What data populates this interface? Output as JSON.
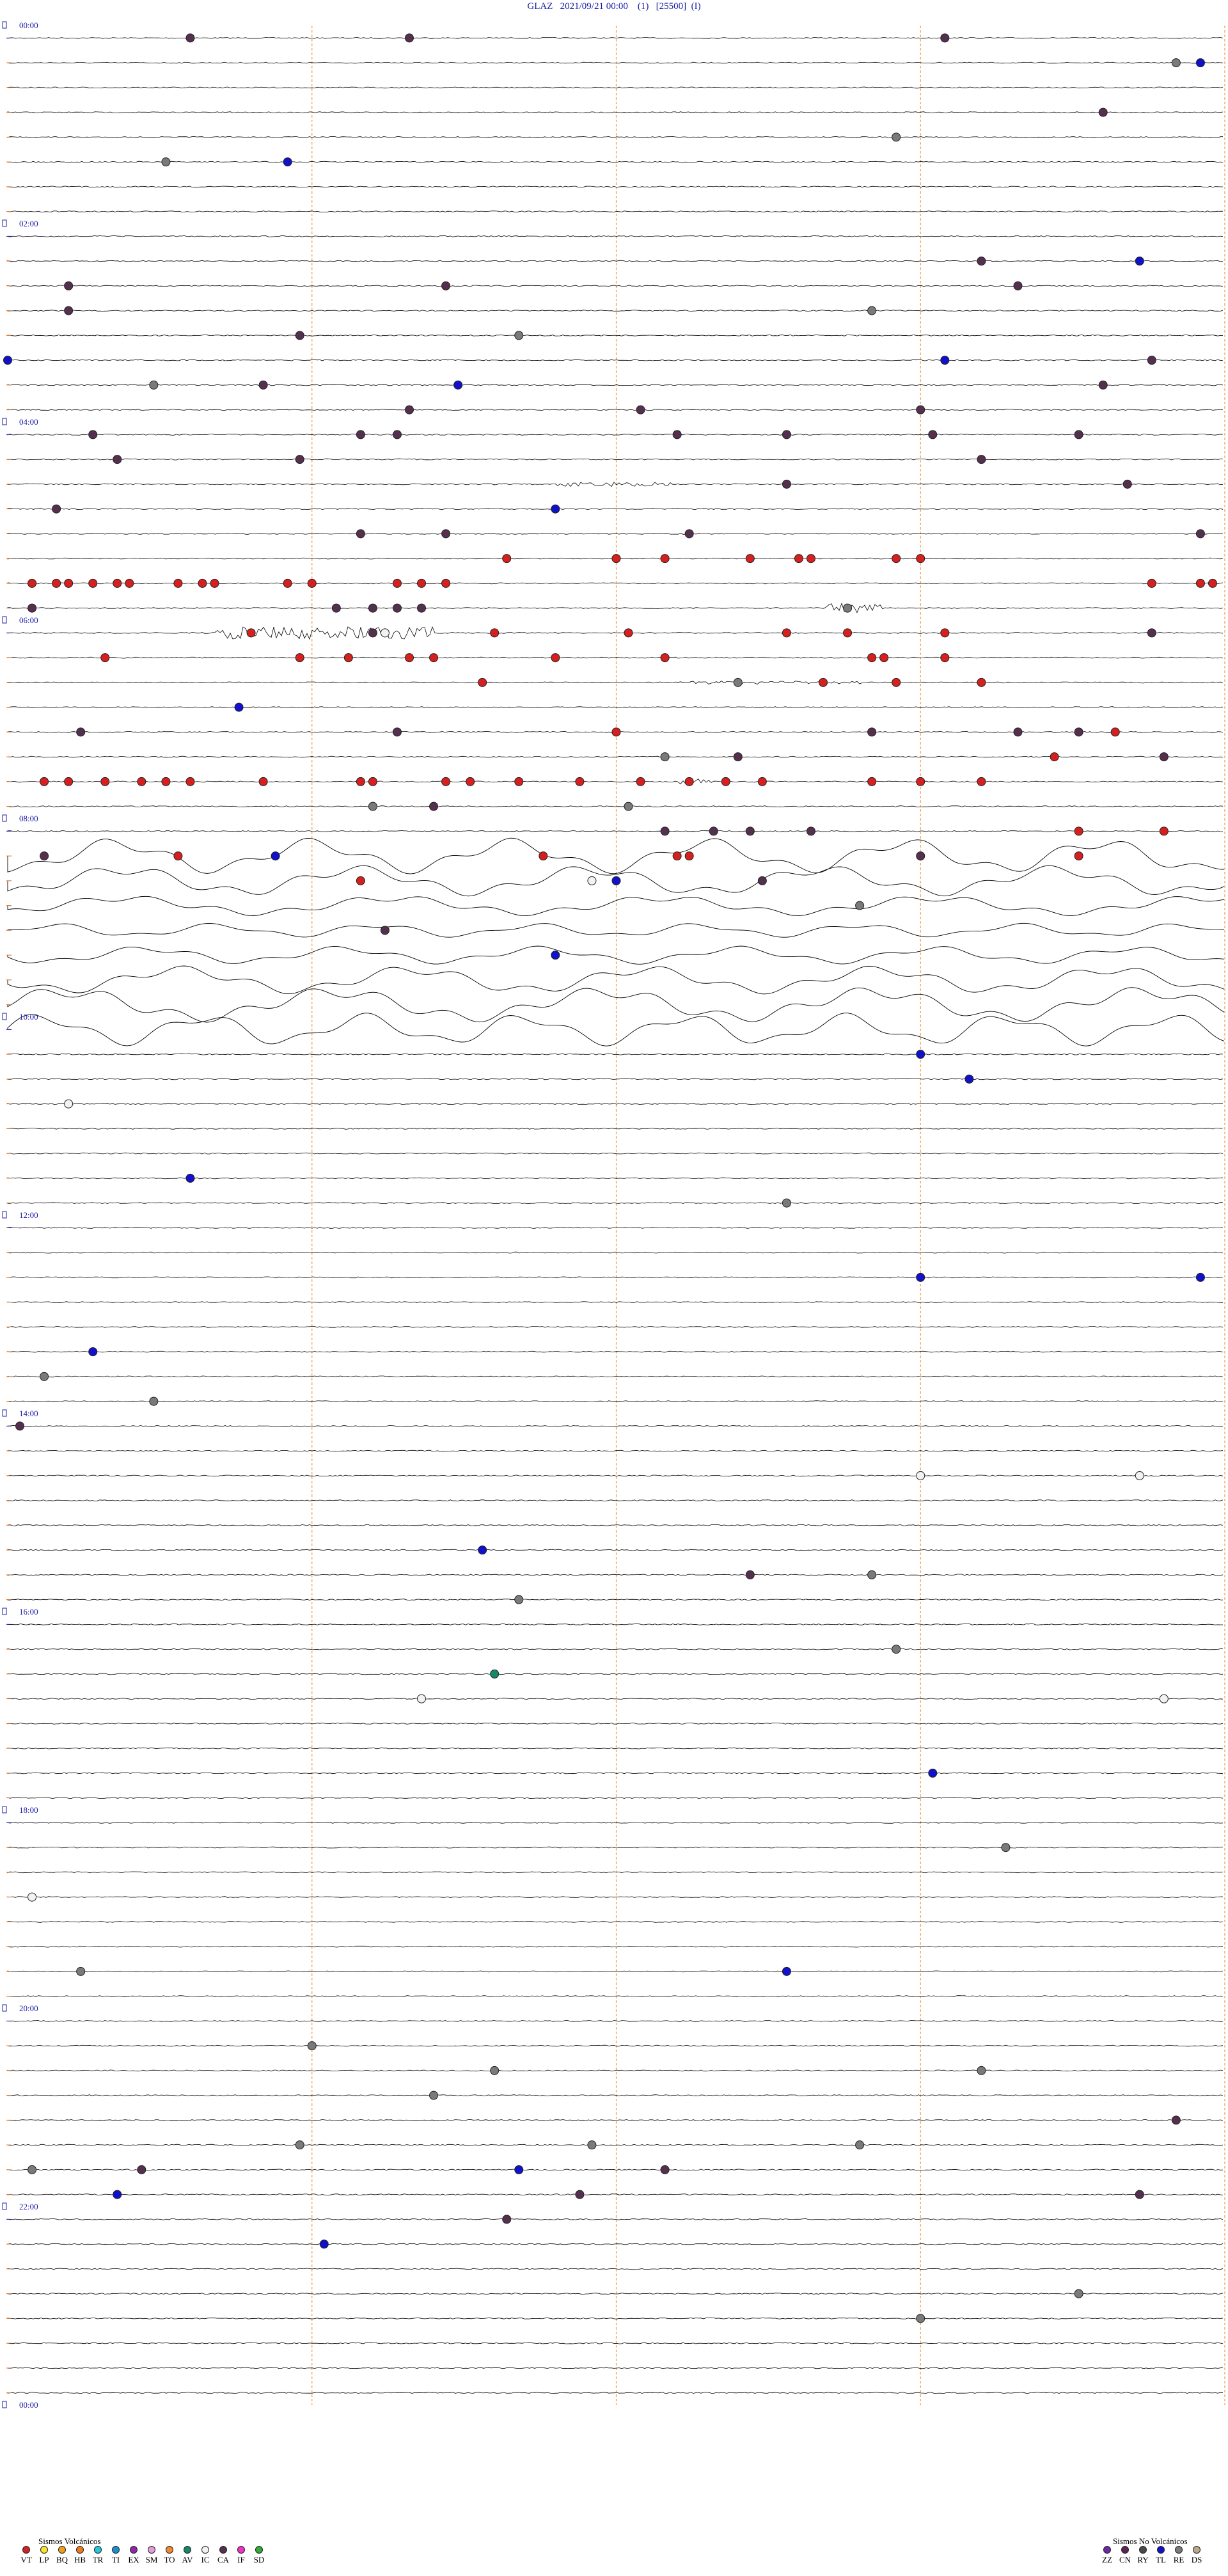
{
  "header": {
    "station": "GLAZ",
    "datetime": "2021/09/21 00:00",
    "channel": "(1)",
    "gain": "[25500]",
    "flag": "(I)"
  },
  "chart_data": {
    "type": "helicorder",
    "station": "GLAZ",
    "start": "2021/09/21 00:00",
    "rows": 96,
    "minutes_per_row": 15,
    "minute_markers": [
      15,
      30,
      45,
      60
    ],
    "hour_labels": [
      {
        "row": 0,
        "text": "00:00"
      },
      {
        "row": 8,
        "text": "02:00"
      },
      {
        "row": 16,
        "text": "04:00"
      },
      {
        "row": 24,
        "text": "06:00"
      },
      {
        "row": 32,
        "text": "08:00"
      },
      {
        "row": 40,
        "text": "10:00"
      },
      {
        "row": 48,
        "text": "12:00"
      },
      {
        "row": 56,
        "text": "14:00"
      },
      {
        "row": 64,
        "text": "16:00"
      },
      {
        "row": 72,
        "text": "18:00"
      },
      {
        "row": 80,
        "text": "20:00"
      },
      {
        "row": 88,
        "text": "22:00"
      },
      {
        "row": 96,
        "text": "00:00"
      }
    ],
    "bursts": [
      {
        "row": 18,
        "start": 45,
        "end": 55,
        "amp": 3
      },
      {
        "row": 23,
        "start": 67,
        "end": 72,
        "amp": 8
      },
      {
        "row": 24,
        "start": 17,
        "end": 35,
        "amp": 10
      },
      {
        "row": 26,
        "start": 55,
        "end": 70,
        "amp": 2
      },
      {
        "row": 30,
        "start": 55,
        "end": 58,
        "amp": 4
      }
    ],
    "noise_rows": {
      "start": 33,
      "end": 40
    },
    "events": [
      {
        "row": 0,
        "x": 15,
        "type": "CA"
      },
      {
        "row": 0,
        "x": 33,
        "type": "CA"
      },
      {
        "row": 0,
        "x": 77,
        "type": "CA"
      },
      {
        "row": 1,
        "x": 98,
        "type": "TL"
      },
      {
        "row": 1,
        "x": 96,
        "type": "RE"
      },
      {
        "row": 3,
        "x": 90,
        "type": "CA"
      },
      {
        "row": 4,
        "x": 73,
        "type": "RE"
      },
      {
        "row": 5,
        "x": 13,
        "type": "RE"
      },
      {
        "row": 5,
        "x": 23,
        "type": "TL"
      },
      {
        "row": 9,
        "x": 80,
        "type": "CA"
      },
      {
        "row": 9,
        "x": 93,
        "type": "TL"
      },
      {
        "row": 10,
        "x": 5,
        "type": "CA"
      },
      {
        "row": 10,
        "x": 36,
        "type": "CA"
      },
      {
        "row": 10,
        "x": 83,
        "type": "CA"
      },
      {
        "row": 11,
        "x": 5,
        "type": "CA"
      },
      {
        "row": 11,
        "x": 71,
        "type": "RE"
      },
      {
        "row": 12,
        "x": 42,
        "type": "RE"
      },
      {
        "row": 12,
        "x": 24,
        "type": "CA"
      },
      {
        "row": 13,
        "x": 0,
        "type": "TL"
      },
      {
        "row": 13,
        "x": 94,
        "type": "CA"
      },
      {
        "row": 13,
        "x": 77,
        "type": "TL"
      },
      {
        "row": 14,
        "x": 12,
        "type": "RE"
      },
      {
        "row": 14,
        "x": 21,
        "type": "CA"
      },
      {
        "row": 14,
        "x": 37,
        "type": "TL"
      },
      {
        "row": 14,
        "x": 90,
        "type": "CA"
      },
      {
        "row": 15,
        "x": 33,
        "type": "CA"
      },
      {
        "row": 15,
        "x": 52,
        "type": "CA"
      },
      {
        "row": 15,
        "x": 75,
        "type": "CA"
      },
      {
        "row": 16,
        "x": 64,
        "type": "CA"
      },
      {
        "row": 16,
        "x": 7,
        "type": "CA"
      },
      {
        "row": 16,
        "x": 29,
        "type": "CA"
      },
      {
        "row": 16,
        "x": 32,
        "type": "CA"
      },
      {
        "row": 16,
        "x": 55,
        "type": "CA"
      },
      {
        "row": 16,
        "x": 76,
        "type": "CA"
      },
      {
        "row": 16,
        "x": 88,
        "type": "CA"
      },
      {
        "row": 17,
        "x": 9,
        "type": "CA"
      },
      {
        "row": 17,
        "x": 24,
        "type": "CA"
      },
      {
        "row": 17,
        "x": 80,
        "type": "CA"
      },
      {
        "row": 18,
        "x": 64,
        "type": "CA"
      },
      {
        "row": 18,
        "x": 92,
        "type": "CA"
      },
      {
        "row": 19,
        "x": 4,
        "type": "CA"
      },
      {
        "row": 19,
        "x": 45,
        "type": "TL"
      },
      {
        "row": 20,
        "x": 29,
        "type": "CA"
      },
      {
        "row": 20,
        "x": 36,
        "type": "CA"
      },
      {
        "row": 20,
        "x": 56,
        "type": "CA"
      },
      {
        "row": 20,
        "x": 98,
        "type": "CA"
      },
      {
        "row": 21,
        "x": 41,
        "type": "VT"
      },
      {
        "row": 21,
        "x": 50,
        "type": "VT"
      },
      {
        "row": 21,
        "x": 54,
        "type": "VT"
      },
      {
        "row": 21,
        "x": 61,
        "type": "VT"
      },
      {
        "row": 21,
        "x": 65,
        "type": "VT"
      },
      {
        "row": 21,
        "x": 66,
        "type": "VT"
      },
      {
        "row": 21,
        "x": 73,
        "type": "VT"
      },
      {
        "row": 21,
        "x": 75,
        "type": "VT"
      },
      {
        "row": 22,
        "x": 2,
        "type": "VT"
      },
      {
        "row": 22,
        "x": 4,
        "type": "VT"
      },
      {
        "row": 22,
        "x": 5,
        "type": "VT"
      },
      {
        "row": 22,
        "x": 7,
        "type": "VT"
      },
      {
        "row": 22,
        "x": 9,
        "type": "VT"
      },
      {
        "row": 22,
        "x": 10,
        "type": "VT"
      },
      {
        "row": 22,
        "x": 14,
        "type": "VT"
      },
      {
        "row": 22,
        "x": 16,
        "type": "VT"
      },
      {
        "row": 22,
        "x": 17,
        "type": "VT"
      },
      {
        "row": 22,
        "x": 23,
        "type": "VT"
      },
      {
        "row": 22,
        "x": 25,
        "type": "VT"
      },
      {
        "row": 22,
        "x": 32,
        "type": "VT"
      },
      {
        "row": 22,
        "x": 34,
        "type": "VT"
      },
      {
        "row": 22,
        "x": 36,
        "type": "VT"
      },
      {
        "row": 22,
        "x": 94,
        "type": "VT"
      },
      {
        "row": 22,
        "x": 98,
        "type": "VT"
      },
      {
        "row": 22,
        "x": 99,
        "type": "VT"
      },
      {
        "row": 23,
        "x": 2,
        "type": "CA"
      },
      {
        "row": 23,
        "x": 27,
        "type": "CA"
      },
      {
        "row": 23,
        "x": 30,
        "type": "CA"
      },
      {
        "row": 23,
        "x": 32,
        "type": "CA"
      },
      {
        "row": 23,
        "x": 34,
        "type": "CA"
      },
      {
        "row": 23,
        "x": 69,
        "type": "RE"
      },
      {
        "row": 24,
        "x": 20,
        "type": "VT"
      },
      {
        "row": 24,
        "x": 30,
        "type": "CA"
      },
      {
        "row": 24,
        "x": 31,
        "type": "IC"
      },
      {
        "row": 24,
        "x": 40,
        "type": "VT"
      },
      {
        "row": 24,
        "x": 51,
        "type": "VT"
      },
      {
        "row": 24,
        "x": 64,
        "type": "VT"
      },
      {
        "row": 24,
        "x": 69,
        "type": "VT"
      },
      {
        "row": 24,
        "x": 77,
        "type": "VT"
      },
      {
        "row": 24,
        "x": 94,
        "type": "CA"
      },
      {
        "row": 25,
        "x": 8,
        "type": "VT"
      },
      {
        "row": 25,
        "x": 24,
        "type": "VT"
      },
      {
        "row": 25,
        "x": 28,
        "type": "VT"
      },
      {
        "row": 25,
        "x": 33,
        "type": "VT"
      },
      {
        "row": 25,
        "x": 35,
        "type": "VT"
      },
      {
        "row": 25,
        "x": 45,
        "type": "VT"
      },
      {
        "row": 25,
        "x": 54,
        "type": "VT"
      },
      {
        "row": 25,
        "x": 71,
        "type": "VT"
      },
      {
        "row": 25,
        "x": 72,
        "type": "VT"
      },
      {
        "row": 25,
        "x": 77,
        "type": "VT"
      },
      {
        "row": 26,
        "x": 39,
        "type": "VT"
      },
      {
        "row": 26,
        "x": 60,
        "type": "RE"
      },
      {
        "row": 26,
        "x": 67,
        "type": "VT"
      },
      {
        "row": 26,
        "x": 73,
        "type": "VT"
      },
      {
        "row": 26,
        "x": 80,
        "type": "VT"
      },
      {
        "row": 27,
        "x": 19,
        "type": "TL"
      },
      {
        "row": 28,
        "x": 6,
        "type": "CA"
      },
      {
        "row": 28,
        "x": 32,
        "type": "CA"
      },
      {
        "row": 28,
        "x": 83,
        "type": "CA"
      },
      {
        "row": 28,
        "x": 88,
        "type": "CA"
      },
      {
        "row": 28,
        "x": 91,
        "type": "VT"
      },
      {
        "row": 28,
        "x": 50,
        "type": "VT"
      },
      {
        "row": 28,
        "x": 71,
        "type": "CA"
      },
      {
        "row": 29,
        "x": 54,
        "type": "RE"
      },
      {
        "row": 29,
        "x": 60,
        "type": "CA"
      },
      {
        "row": 29,
        "x": 86,
        "type": "VT"
      },
      {
        "row": 29,
        "x": 95,
        "type": "CA"
      },
      {
        "row": 30,
        "x": 3,
        "type": "VT"
      },
      {
        "row": 30,
        "x": 5,
        "type": "VT"
      },
      {
        "row": 30,
        "x": 8,
        "type": "VT"
      },
      {
        "row": 30,
        "x": 11,
        "type": "VT"
      },
      {
        "row": 30,
        "x": 13,
        "type": "VT"
      },
      {
        "row": 30,
        "x": 15,
        "type": "VT"
      },
      {
        "row": 30,
        "x": 21,
        "type": "VT"
      },
      {
        "row": 30,
        "x": 29,
        "type": "VT"
      },
      {
        "row": 30,
        "x": 30,
        "type": "VT"
      },
      {
        "row": 30,
        "x": 36,
        "type": "VT"
      },
      {
        "row": 30,
        "x": 38,
        "type": "VT"
      },
      {
        "row": 30,
        "x": 42,
        "type": "VT"
      },
      {
        "row": 30,
        "x": 47,
        "type": "VT"
      },
      {
        "row": 30,
        "x": 52,
        "type": "VT"
      },
      {
        "row": 30,
        "x": 56,
        "type": "VT"
      },
      {
        "row": 30,
        "x": 59,
        "type": "VT"
      },
      {
        "row": 30,
        "x": 62,
        "type": "VT"
      },
      {
        "row": 30,
        "x": 71,
        "type": "VT"
      },
      {
        "row": 30,
        "x": 75,
        "type": "VT"
      },
      {
        "row": 30,
        "x": 80,
        "type": "VT"
      },
      {
        "row": 31,
        "x": 30,
        "type": "RE"
      },
      {
        "row": 31,
        "x": 35,
        "type": "CA"
      },
      {
        "row": 31,
        "x": 51,
        "type": "RE"
      },
      {
        "row": 32,
        "x": 54,
        "type": "CA"
      },
      {
        "row": 32,
        "x": 58,
        "type": "CA"
      },
      {
        "row": 32,
        "x": 66,
        "type": "CA"
      },
      {
        "row": 32,
        "x": 61,
        "type": "CA"
      },
      {
        "row": 32,
        "x": 88,
        "type": "VT"
      },
      {
        "row": 32,
        "x": 95,
        "type": "VT"
      },
      {
        "row": 33,
        "x": 3,
        "type": "CA"
      },
      {
        "row": 33,
        "x": 14,
        "type": "VT"
      },
      {
        "row": 33,
        "x": 22,
        "type": "TL"
      },
      {
        "row": 33,
        "x": 44,
        "type": "VT"
      },
      {
        "row": 33,
        "x": 55,
        "type": "VT"
      },
      {
        "row": 33,
        "x": 56,
        "type": "VT"
      },
      {
        "row": 33,
        "x": 75,
        "type": "CA"
      },
      {
        "row": 33,
        "x": 88,
        "type": "VT"
      },
      {
        "row": 34,
        "x": 29,
        "type": "VT"
      },
      {
        "row": 34,
        "x": 48,
        "type": "IC"
      },
      {
        "row": 34,
        "x": 50,
        "type": "TL"
      },
      {
        "row": 34,
        "x": 62,
        "type": "CA"
      },
      {
        "row": 35,
        "x": 70,
        "type": "RE"
      },
      {
        "row": 36,
        "x": 31,
        "type": "CA"
      },
      {
        "row": 37,
        "x": 45,
        "type": "TL"
      },
      {
        "row": 41,
        "x": 75,
        "type": "TL"
      },
      {
        "row": 42,
        "x": 79,
        "type": "TL"
      },
      {
        "row": 43,
        "x": 5,
        "type": "IC"
      },
      {
        "row": 46,
        "x": 15,
        "type": "TL"
      },
      {
        "row": 47,
        "x": 64,
        "type": "RE"
      },
      {
        "row": 50,
        "x": 75,
        "type": "TL"
      },
      {
        "row": 50,
        "x": 98,
        "type": "TL"
      },
      {
        "row": 53,
        "x": 7,
        "type": "TL"
      },
      {
        "row": 54,
        "x": 3,
        "type": "RE"
      },
      {
        "row": 55,
        "x": 12,
        "type": "RE"
      },
      {
        "row": 56,
        "x": 1,
        "type": "CA"
      },
      {
        "row": 58,
        "x": 93,
        "type": "IC"
      },
      {
        "row": 58,
        "x": 75,
        "type": "IC"
      },
      {
        "row": 61,
        "x": 39,
        "type": "TL"
      },
      {
        "row": 62,
        "x": 61,
        "type": "CA"
      },
      {
        "row": 62,
        "x": 71,
        "type": "RE"
      },
      {
        "row": 63,
        "x": 42,
        "type": "RE"
      },
      {
        "row": 65,
        "x": 73,
        "type": "RE"
      },
      {
        "row": 66,
        "x": 40,
        "type": "AV"
      },
      {
        "row": 67,
        "x": 34,
        "type": "IC"
      },
      {
        "row": 67,
        "x": 95,
        "type": "IC"
      },
      {
        "row": 70,
        "x": 76,
        "type": "TL"
      },
      {
        "row": 73,
        "x": 82,
        "type": "RE"
      },
      {
        "row": 75,
        "x": 2,
        "type": "IC"
      },
      {
        "row": 78,
        "x": 6,
        "type": "RE"
      },
      {
        "row": 78,
        "x": 64,
        "type": "TL"
      },
      {
        "row": 81,
        "x": 25,
        "type": "RE"
      },
      {
        "row": 82,
        "x": 40,
        "type": "RE"
      },
      {
        "row": 82,
        "x": 80,
        "type": "RE"
      },
      {
        "row": 83,
        "x": 35,
        "type": "RE"
      },
      {
        "row": 84,
        "x": 96,
        "type": "CA"
      },
      {
        "row": 85,
        "x": 24,
        "type": "RE"
      },
      {
        "row": 85,
        "x": 70,
        "type": "RE"
      },
      {
        "row": 85,
        "x": 48,
        "type": "RE"
      },
      {
        "row": 86,
        "x": 2,
        "type": "RE"
      },
      {
        "row": 86,
        "x": 11,
        "type": "CA"
      },
      {
        "row": 86,
        "x": 42,
        "type": "TL"
      },
      {
        "row": 86,
        "x": 54,
        "type": "CA"
      },
      {
        "row": 87,
        "x": 9,
        "type": "TL"
      },
      {
        "row": 87,
        "x": 47,
        "type": "CA"
      },
      {
        "row": 87,
        "x": 93,
        "type": "CA"
      },
      {
        "row": 88,
        "x": 41,
        "type": "CA"
      },
      {
        "row": 89,
        "x": 26,
        "type": "TL"
      },
      {
        "row": 91,
        "x": 88,
        "type": "RE"
      },
      {
        "row": 92,
        "x": 75,
        "type": "RE"
      }
    ]
  },
  "legend": {
    "volcanic_title": "Sismos Volcánicos",
    "volcanic": [
      {
        "code": "VT",
        "color": "#d61f1f"
      },
      {
        "code": "LP",
        "color": "#f5e62a"
      },
      {
        "code": "BQ",
        "color": "#f0a018"
      },
      {
        "code": "HB",
        "color": "#ee7a1c"
      },
      {
        "code": "TR",
        "color": "#22c8d8"
      },
      {
        "code": "TI",
        "color": "#1a8fd0"
      },
      {
        "code": "EX",
        "color": "#8a2aa6"
      },
      {
        "code": "SM",
        "color": "#e49cdc"
      },
      {
        "code": "TO",
        "color": "#f08a30"
      },
      {
        "code": "AV",
        "color": "#17876a"
      },
      {
        "code": "IC",
        "color": "#f2f2f2"
      },
      {
        "code": "CA",
        "color": "#55304e"
      },
      {
        "code": "IF",
        "color": "#ef30c9"
      },
      {
        "code": "SD",
        "color": "#33aa33"
      }
    ],
    "nonvolcanic_title": "Sismos No Volcánicos",
    "nonvolcanic": [
      {
        "code": "ZZ",
        "color": "#6b2aa0"
      },
      {
        "code": "CN",
        "color": "#5e2255"
      },
      {
        "code": "RY",
        "color": "#4a4a4a"
      },
      {
        "code": "TL",
        "color": "#1111cc"
      },
      {
        "code": "RE",
        "color": "#7a7a7a"
      },
      {
        "code": "DS",
        "color": "#b9a88a"
      }
    ]
  }
}
